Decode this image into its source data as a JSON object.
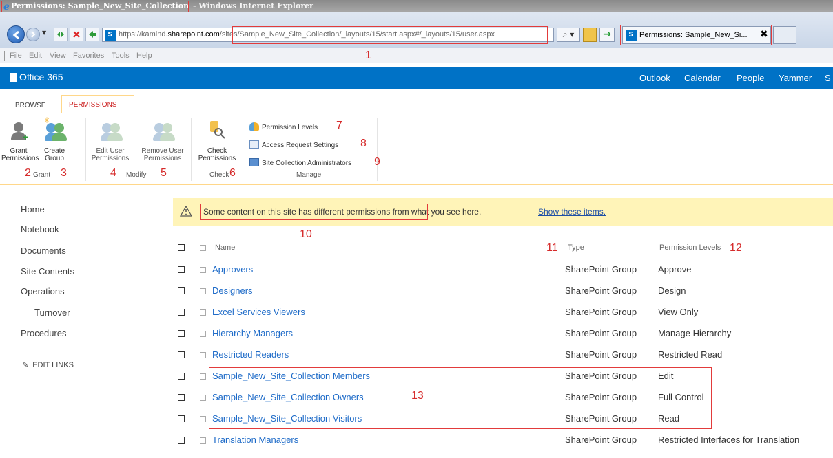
{
  "window": {
    "title": "Permissions: Sample_New_Site_Collection",
    "app_name": "- Windows Internet Explorer"
  },
  "browser": {
    "url_prefix": "https://kamind.",
    "url_host": "sharepoint.com",
    "url_path": "/sites/Sample_New_Site_Collection/_layouts/15/start.aspx#/_layouts/15/user.aspx",
    "tab_label": "Permissions: Sample_New_Si...",
    "search_label": "⌕ ▾",
    "go_label": "→",
    "tab_close": "✖"
  },
  "menu": [
    "File",
    "Edit",
    "View",
    "Favorites",
    "Tools",
    "Help"
  ],
  "suite": {
    "brand": "Office 365",
    "links": [
      "Outlook",
      "Calendar",
      "People",
      "Yammer",
      "S"
    ]
  },
  "ribbon": {
    "tabs": [
      "BROWSE",
      "PERMISSIONS"
    ],
    "buttons": {
      "grant": [
        "Grant",
        "Permissions"
      ],
      "create": [
        "Create",
        "Group"
      ],
      "edit_user": [
        "Edit User",
        "Permissions"
      ],
      "remove_user": [
        "Remove User",
        "Permissions"
      ],
      "check": [
        "Check",
        "Permissions"
      ]
    },
    "groups": [
      "Grant",
      "Modify",
      "Check",
      "Manage"
    ],
    "manage_items": [
      "Permission Levels",
      "Access Request Settings",
      "Site Collection Administrators"
    ]
  },
  "annotations": [
    "1",
    "2",
    "3",
    "4",
    "5",
    "6",
    "7",
    "8",
    "9",
    "10",
    "11",
    "12",
    "13"
  ],
  "leftnav": {
    "items": [
      "Home",
      "Notebook",
      "Documents",
      "Site Contents",
      "Operations",
      "Turnover",
      "Procedures"
    ],
    "edit_links": "EDIT LINKS"
  },
  "banner": {
    "text": "Some content on this site has different permissions from what you see here.",
    "link": "Show these items."
  },
  "table": {
    "headers": [
      "Name",
      "Type",
      "Permission Levels"
    ],
    "rows": [
      {
        "name": "Approvers",
        "type": "SharePoint Group",
        "permission": "Approve"
      },
      {
        "name": "Designers",
        "type": "SharePoint Group",
        "permission": "Design"
      },
      {
        "name": "Excel Services Viewers",
        "type": "SharePoint Group",
        "permission": "View Only"
      },
      {
        "name": "Hierarchy Managers",
        "type": "SharePoint Group",
        "permission": "Manage Hierarchy"
      },
      {
        "name": "Restricted Readers",
        "type": "SharePoint Group",
        "permission": "Restricted Read"
      },
      {
        "name": "Sample_New_Site_Collection Members",
        "type": "SharePoint Group",
        "permission": "Edit"
      },
      {
        "name": "Sample_New_Site_Collection Owners",
        "type": "SharePoint Group",
        "permission": "Full Control"
      },
      {
        "name": "Sample_New_Site_Collection Visitors",
        "type": "SharePoint Group",
        "permission": "Read"
      },
      {
        "name": "Translation Managers",
        "type": "SharePoint Group",
        "permission": "Restricted Interfaces for Translation"
      }
    ]
  },
  "colors": {
    "suite_blue": "#0072c6",
    "link_blue": "#1e6bc8",
    "annotation_red": "#d62b2b",
    "banner_yellow": "#fff4b8",
    "ribbon_accent": "#ffd78a"
  }
}
